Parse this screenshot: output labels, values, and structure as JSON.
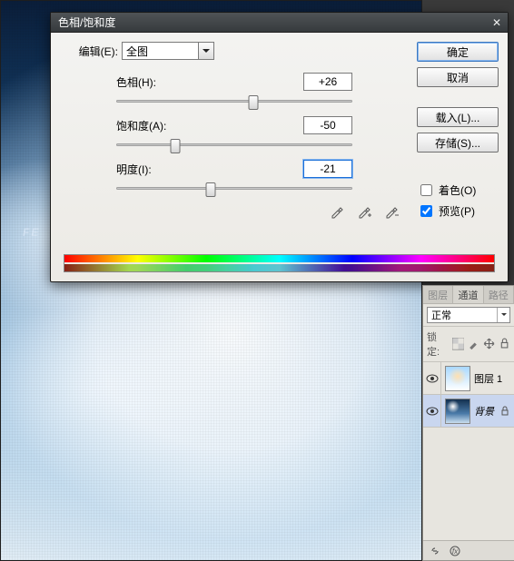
{
  "dialog": {
    "title": "色相/饱和度",
    "edit_label": "编辑(E):",
    "edit_value": "全图",
    "hue": {
      "label": "色相(H):",
      "value": "+26",
      "pos": 58
    },
    "sat": {
      "label": "饱和度(A):",
      "value": "-50",
      "pos": 25
    },
    "lig": {
      "label": "明度(I):",
      "value": "-21",
      "pos": 40
    },
    "colorize_label": "着色(O)",
    "preview_label": "预览(P)",
    "buttons": {
      "ok": "确定",
      "cancel": "取消",
      "load": "载入(L)...",
      "save": "存储(S)..."
    }
  },
  "panel": {
    "tabs": {
      "t1": "图层",
      "t2": "通道",
      "t3": "路径"
    },
    "mode": "正常",
    "lock_label": "锁定:",
    "layers": [
      {
        "name": "图层 1",
        "italic": false
      },
      {
        "name": "背景",
        "italic": true
      }
    ]
  },
  "watermark": "FE"
}
